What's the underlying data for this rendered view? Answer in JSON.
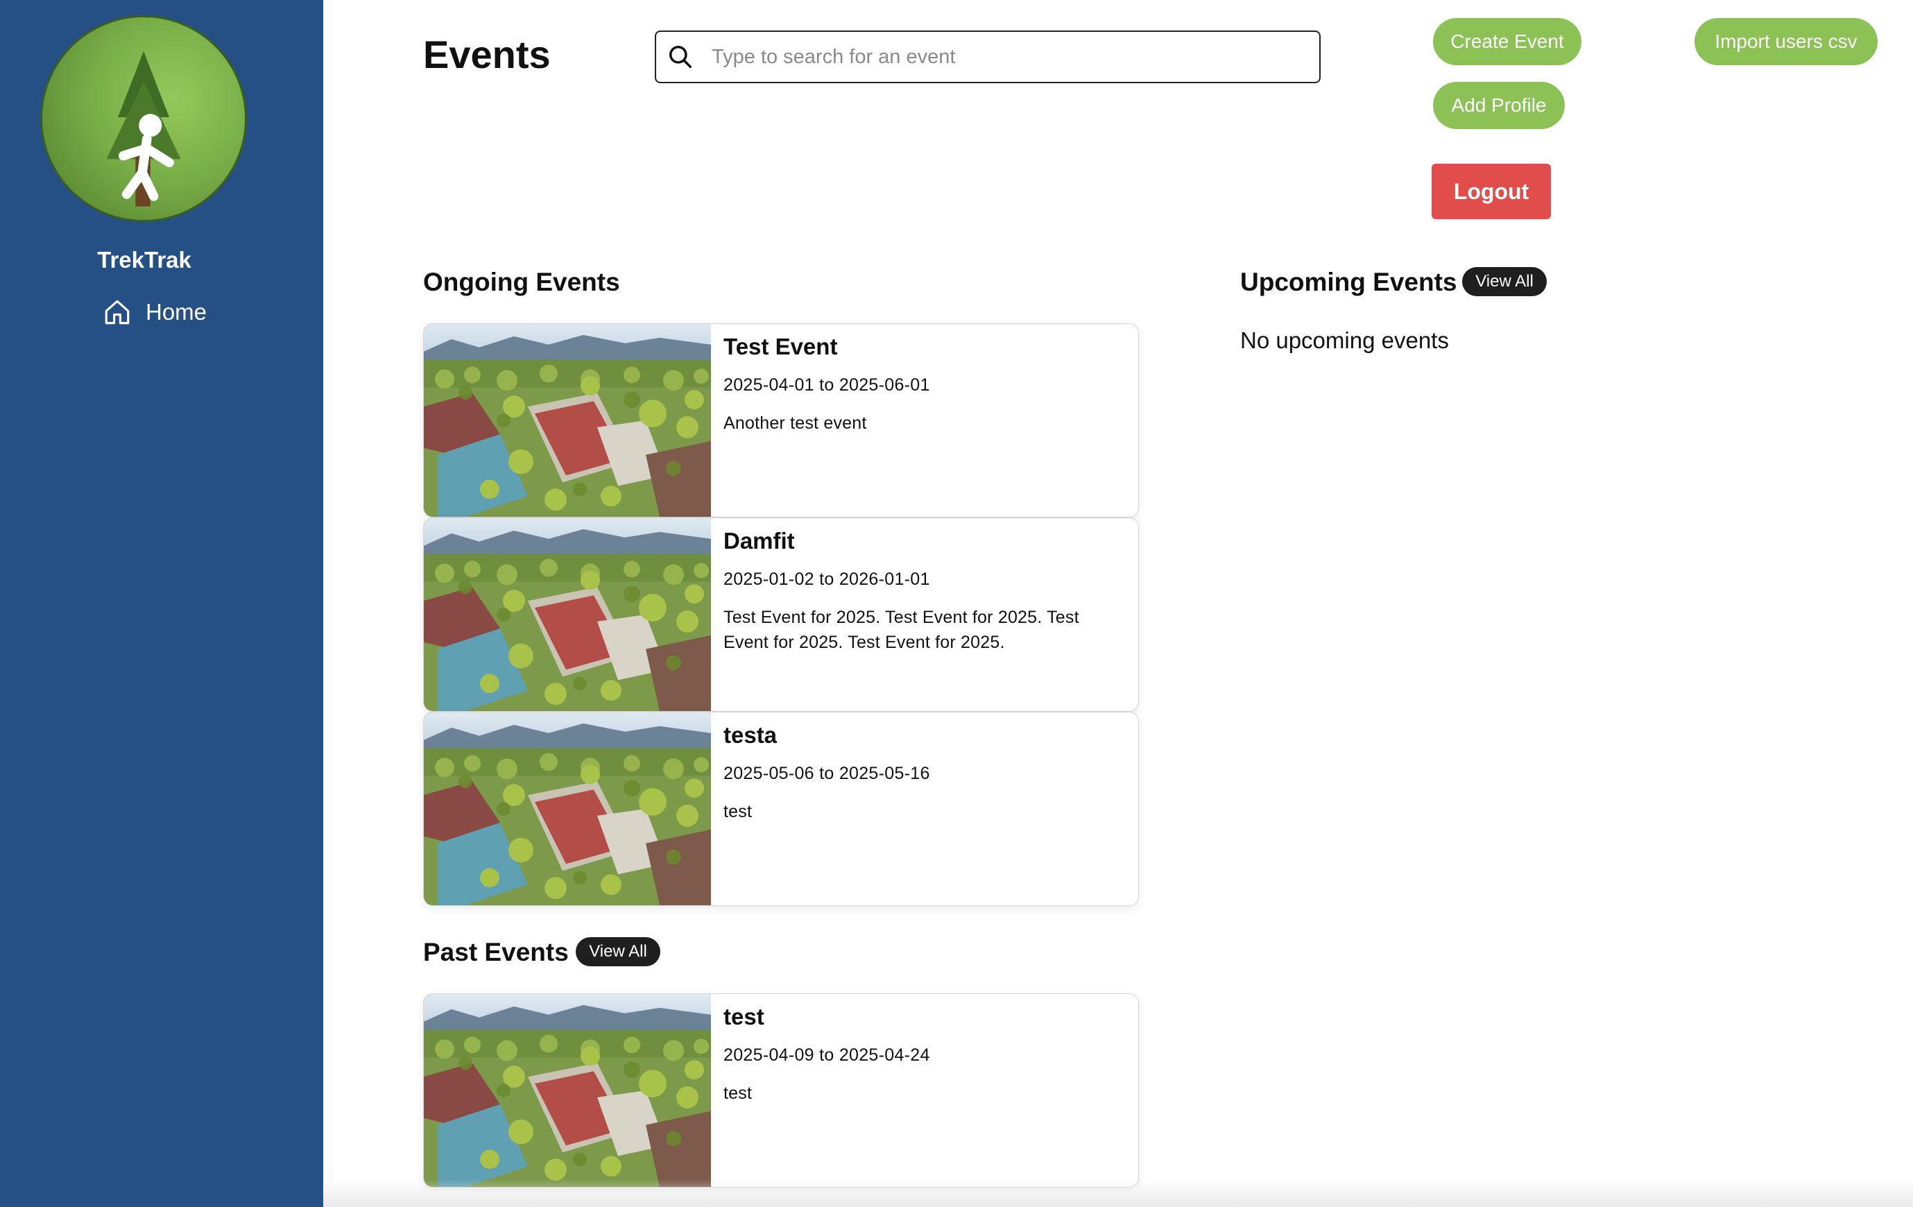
{
  "sidebar": {
    "brand": "TrekTrak",
    "nav": [
      {
        "label": "Home",
        "icon": "home-icon"
      }
    ]
  },
  "header": {
    "title": "Events",
    "search_placeholder": "Type to search for an event",
    "search_value": "",
    "create_event": "Create Event",
    "import_users": "Import users csv",
    "add_profile": "Add Profile",
    "logout": "Logout"
  },
  "colors": {
    "sidebar": "#245086",
    "green_button": "#8cc155",
    "logout_button": "#e04d4b",
    "pill": "#1f1f1f"
  },
  "ongoing": {
    "title": "Ongoing Events",
    "events": [
      {
        "name": "Test Event",
        "dates": "2025-04-01 to 2025-06-01",
        "description": "Another test event"
      },
      {
        "name": "Damfit",
        "dates": "2025-01-02 to 2026-01-01",
        "description": "Test Event for 2025. Test Event for 2025. Test Event for 2025. Test Event for 2025."
      },
      {
        "name": "testa",
        "dates": "2025-05-06 to 2025-05-16",
        "description": "test"
      }
    ]
  },
  "upcoming": {
    "title": "Upcoming Events",
    "view_all": "View All",
    "empty_text": "No upcoming events"
  },
  "past": {
    "title": "Past Events",
    "view_all": "View All",
    "events": [
      {
        "name": "test",
        "dates": "2025-04-09 to 2025-04-24",
        "description": "test"
      }
    ]
  }
}
